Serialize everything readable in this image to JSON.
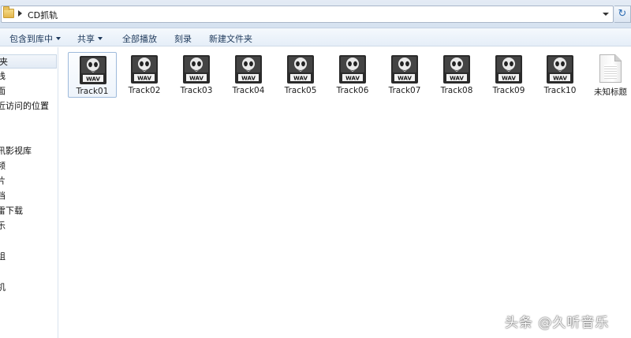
{
  "address": {
    "path_text": "CD抓轨"
  },
  "toolbar": {
    "include_in_library": "包含到库中",
    "share": "共享",
    "play_all": "全部播放",
    "burn": "刻录",
    "new_folder": "新建文件夹"
  },
  "nav": {
    "items": [
      {
        "label": "夹",
        "selected": true
      },
      {
        "label": "栈"
      },
      {
        "label": "面"
      },
      {
        "label": "近访问的位置"
      },
      {
        "label": "讯影视库"
      },
      {
        "label": "频"
      },
      {
        "label": "片"
      },
      {
        "label": "档"
      },
      {
        "label": "雷下载"
      },
      {
        "label": "乐"
      },
      {
        "label": "组"
      },
      {
        "label": "机"
      }
    ]
  },
  "files": [
    {
      "name": "Track01",
      "icon": "wav-file-icon",
      "badge": "WAV",
      "selected": true
    },
    {
      "name": "Track02",
      "icon": "wav-file-icon",
      "badge": "WAV"
    },
    {
      "name": "Track03",
      "icon": "wav-file-icon",
      "badge": "WAV"
    },
    {
      "name": "Track04",
      "icon": "wav-file-icon",
      "badge": "WAV"
    },
    {
      "name": "Track05",
      "icon": "wav-file-icon",
      "badge": "WAV"
    },
    {
      "name": "Track06",
      "icon": "wav-file-icon",
      "badge": "WAV"
    },
    {
      "name": "Track07",
      "icon": "wav-file-icon",
      "badge": "WAV"
    },
    {
      "name": "Track08",
      "icon": "wav-file-icon",
      "badge": "WAV"
    },
    {
      "name": "Track09",
      "icon": "wav-file-icon",
      "badge": "WAV"
    },
    {
      "name": "Track10",
      "icon": "wav-file-icon",
      "badge": "WAV"
    },
    {
      "name": "未知标题",
      "icon": "text-document-icon"
    }
  ],
  "watermark": "头条 @久听音乐"
}
